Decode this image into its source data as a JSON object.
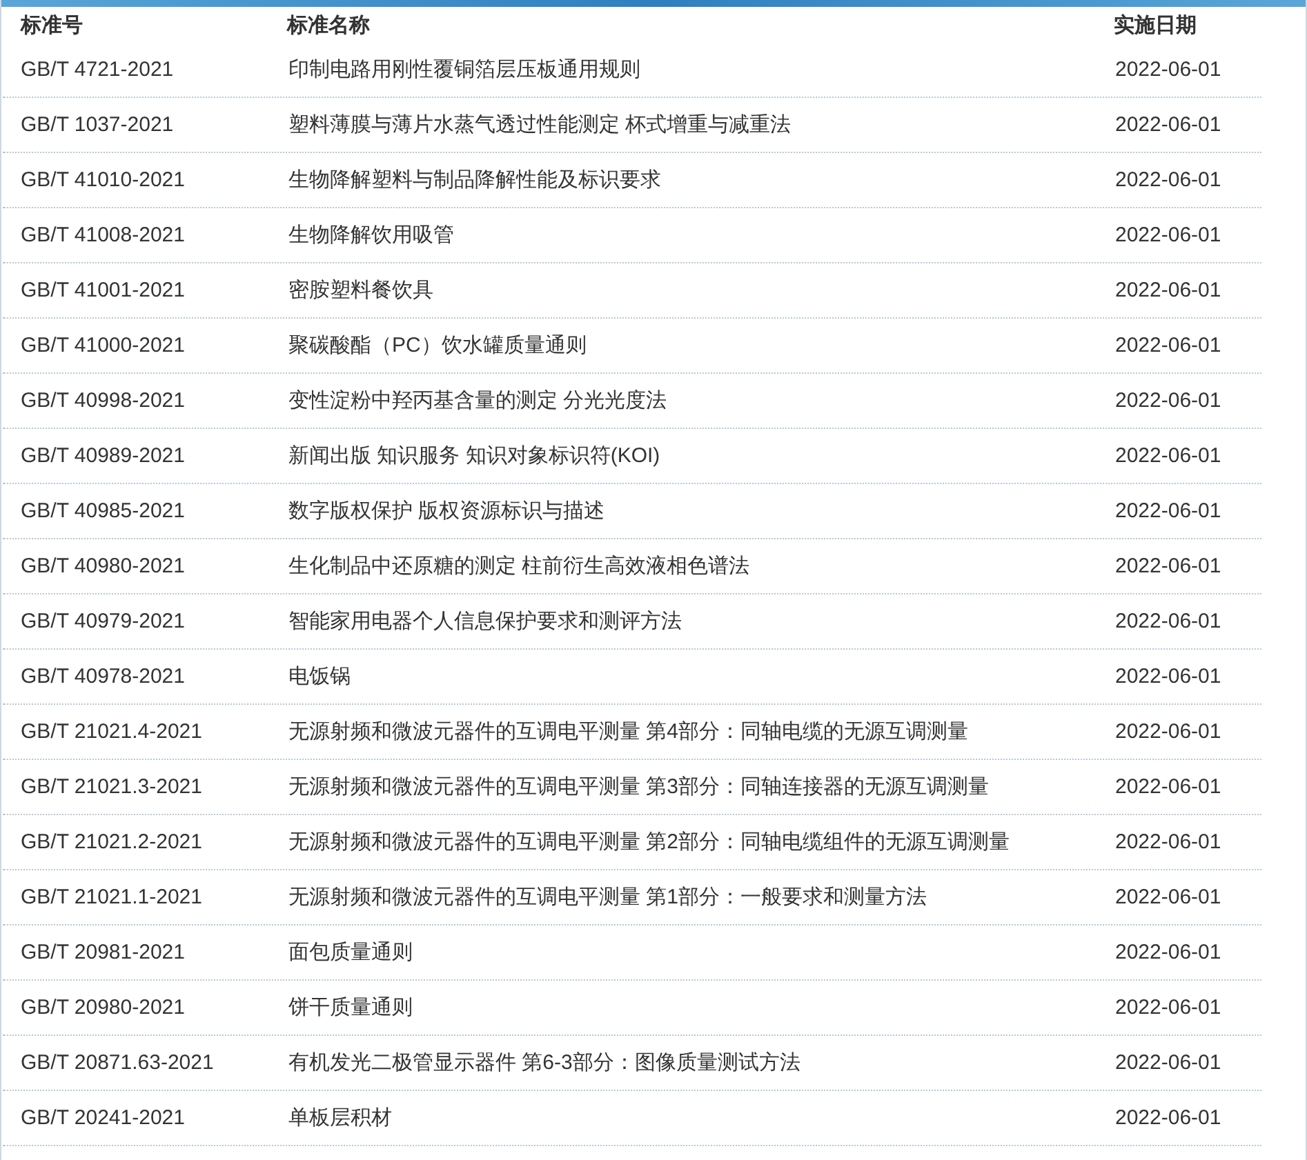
{
  "table": {
    "columns": [
      "标准号",
      "标准名称",
      "实施日期"
    ],
    "rows": [
      [
        "GB/T 4721-2021",
        "印制电路用刚性覆铜箔层压板通用规则",
        "2022-06-01"
      ],
      [
        "GB/T 1037-2021",
        "塑料薄膜与薄片水蒸气透过性能测定 杯式增重与减重法",
        "2022-06-01"
      ],
      [
        "GB/T 41010-2021",
        "生物降解塑料与制品降解性能及标识要求",
        "2022-06-01"
      ],
      [
        "GB/T 41008-2021",
        "生物降解饮用吸管",
        "2022-06-01"
      ],
      [
        "GB/T 41001-2021",
        "密胺塑料餐饮具",
        "2022-06-01"
      ],
      [
        "GB/T 41000-2021",
        "聚碳酸酯（PC）饮水罐质量通则",
        "2022-06-01"
      ],
      [
        "GB/T 40998-2021",
        "变性淀粉中羟丙基含量的测定 分光光度法",
        "2022-06-01"
      ],
      [
        "GB/T 40989-2021",
        "新闻出版 知识服务 知识对象标识符(KOI)",
        "2022-06-01"
      ],
      [
        "GB/T 40985-2021",
        "数字版权保护 版权资源标识与描述",
        "2022-06-01"
      ],
      [
        "GB/T 40980-2021",
        "生化制品中还原糖的测定 柱前衍生高效液相色谱法",
        "2022-06-01"
      ],
      [
        "GB/T 40979-2021",
        "智能家用电器个人信息保护要求和测评方法",
        "2022-06-01"
      ],
      [
        "GB/T 40978-2021",
        "电饭锅",
        "2022-06-01"
      ],
      [
        "GB/T 21021.4-2021",
        "无源射频和微波元器件的互调电平测量 第4部分：同轴电缆的无源互调测量",
        "2022-06-01"
      ],
      [
        "GB/T 21021.3-2021",
        "无源射频和微波元器件的互调电平测量 第3部分：同轴连接器的无源互调测量",
        "2022-06-01"
      ],
      [
        "GB/T 21021.2-2021",
        "无源射频和微波元器件的互调电平测量 第2部分：同轴电缆组件的无源互调测量",
        "2022-06-01"
      ],
      [
        "GB/T 21021.1-2021",
        "无源射频和微波元器件的互调电平测量 第1部分：一般要求和测量方法",
        "2022-06-01"
      ],
      [
        "GB/T 20981-2021",
        "面包质量通则",
        "2022-06-01"
      ],
      [
        "GB/T 20980-2021",
        "饼干质量通则",
        "2022-06-01"
      ],
      [
        "GB/T 20871.63-2021",
        "有机发光二极管显示器件 第6-3部分：图像质量测试方法",
        "2022-06-01"
      ],
      [
        "GB/T 20241-2021",
        "单板层积材",
        "2022-06-01"
      ]
    ]
  }
}
